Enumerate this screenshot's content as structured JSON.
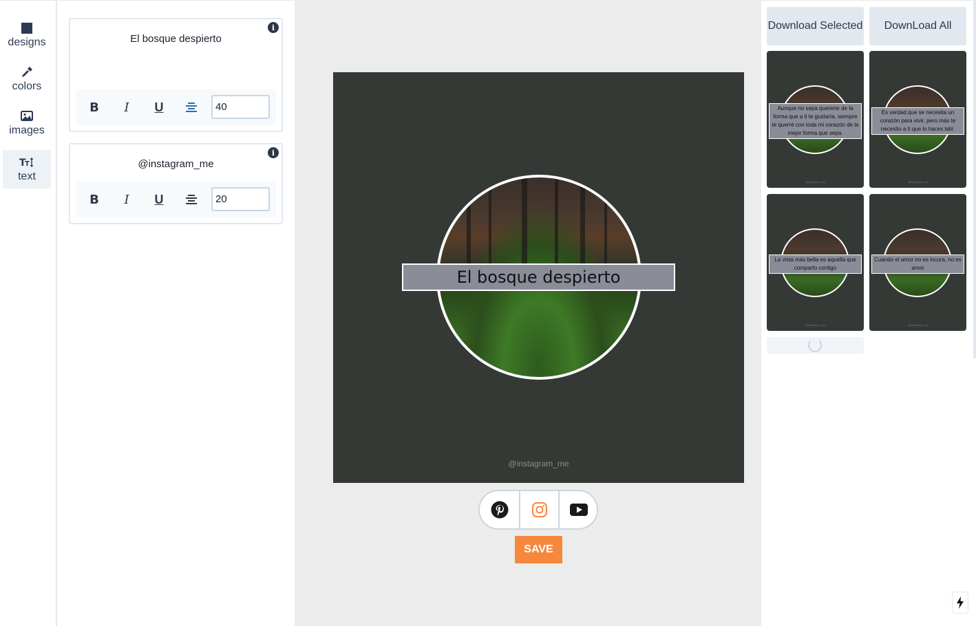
{
  "nav": {
    "items": [
      {
        "label": "designs",
        "icon": "square-icon"
      },
      {
        "label": "colors",
        "icon": "eyedropper-icon"
      },
      {
        "label": "images",
        "icon": "image-icon"
      },
      {
        "label": "text",
        "icon": "text-height-icon"
      }
    ],
    "active": "text"
  },
  "text_panel": {
    "cards": [
      {
        "text": "El bosque despierto",
        "font_size": "40"
      },
      {
        "text": "@instagram_me",
        "font_size": "20"
      }
    ],
    "toolbar": {
      "bold": "B",
      "italic": "I",
      "underline": "U"
    }
  },
  "canvas": {
    "title": "El bosque despierto",
    "handle": "@instagram_me",
    "background": "#343936",
    "banner_color": "#8a8c98"
  },
  "social": [
    "pinterest-icon",
    "instagram-icon",
    "youtube-icon"
  ],
  "save_label": "SAVE",
  "accent": "#f6873d",
  "right": {
    "download_selected": "Download Selected",
    "download_all": "DownLoad All",
    "thumbnails": [
      {
        "text": "Aunque no sepa quererte de la forma que a ti te gustaría, siempre te querré con toda mi corazón de la mejor forma que sepa.",
        "handle": "@instagram_me"
      },
      {
        "text": "Es verdad que se necesita un corazón para vivir, pero más te necesito a ti que lo haces latir.",
        "handle": "@instagram_me"
      },
      {
        "text": "La vista más bella es aquella que comparto contigo",
        "handle": "@instagram_me"
      },
      {
        "text": "Cuando el amor no es locura, no es amor",
        "handle": "@instagram_me"
      }
    ]
  }
}
